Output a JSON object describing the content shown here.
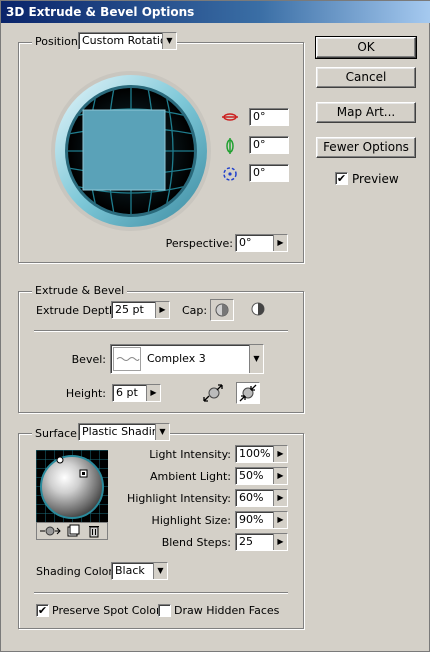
{
  "window": {
    "title": "3D Extrude & Bevel Options"
  },
  "buttons": {
    "ok": "OK",
    "cancel": "Cancel",
    "map_art": "Map Art...",
    "fewer_options": "Fewer Options"
  },
  "preview": {
    "label": "Preview",
    "checked": true
  },
  "position": {
    "label": "Position:",
    "value": "Custom Rotation",
    "x_rotation": "0°",
    "y_rotation": "0°",
    "z_rotation": "0°",
    "perspective_label": "Perspective:",
    "perspective_value": "0°"
  },
  "extrude": {
    "group_title": "Extrude & Bevel",
    "depth_label": "Extrude Depth:",
    "depth_value": "25 pt",
    "cap_label": "Cap:",
    "bevel_label": "Bevel:",
    "bevel_value": "Complex 3",
    "height_label": "Height:",
    "height_value": "6 pt"
  },
  "surface": {
    "label": "Surface:",
    "value": "Plastic Shading",
    "light_intensity_label": "Light Intensity:",
    "light_intensity_value": "100%",
    "ambient_light_label": "Ambient Light:",
    "ambient_light_value": "50%",
    "highlight_intensity_label": "Highlight Intensity:",
    "highlight_intensity_value": "60%",
    "highlight_size_label": "Highlight Size:",
    "highlight_size_value": "90%",
    "blend_steps_label": "Blend Steps:",
    "blend_steps_value": "25",
    "shading_color_label": "Shading Color:",
    "shading_color_value": "Black",
    "preserve_spot_label": "Preserve Spot Colors",
    "preserve_spot_checked": true,
    "draw_hidden_label": "Draw Hidden Faces",
    "draw_hidden_checked": false
  },
  "colors": {
    "title_start": "#0a246a",
    "cube_face": "#5aa2b8",
    "track_ring": "#7ec8d8"
  }
}
